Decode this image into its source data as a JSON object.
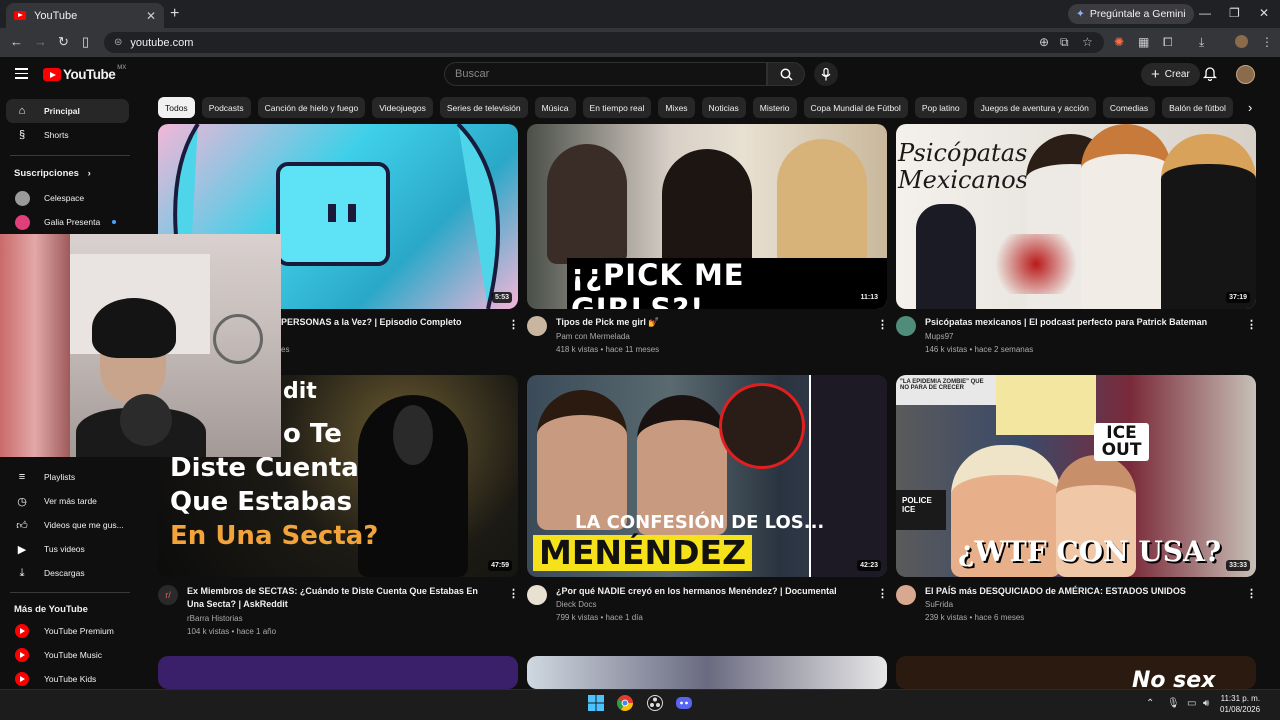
{
  "browser": {
    "tab_title": "YouTube",
    "new_tab": "+",
    "gemini_label": "Pregúntale a Gemini",
    "url": "youtube.com"
  },
  "yt": {
    "logo_text": "YouTube",
    "region": "MX",
    "search_placeholder": "Buscar",
    "create_label": "Crear"
  },
  "chips": [
    "Todos",
    "Podcasts",
    "Canción de hielo y fuego",
    "Videojuegos",
    "Series de televisión",
    "Música",
    "En tiempo real",
    "Mixes",
    "Noticias",
    "Misterio",
    "Copa Mundial de Fútbol",
    "Pop latino",
    "Juegos de aventura y acción",
    "Comedias",
    "Balón de fútbol"
  ],
  "sidebar": {
    "principal": "Principal",
    "shorts": "Shorts",
    "subs_header": "Suscripciones",
    "subs": [
      {
        "name": "Celespace",
        "color": "#b8b8b8"
      },
      {
        "name": "Galia Presenta",
        "color": "#e0407a"
      }
    ],
    "you_items": [
      "Playlists",
      "Ver más tarde",
      "Videos que me gus...",
      "Tus videos",
      "Descargas"
    ],
    "more_header": "Más de YouTube",
    "more_items": [
      "YouTube Premium",
      "YouTube Music",
      "YouTube Kids"
    ]
  },
  "videos": [
    {
      "title": "PERSONAS a la Vez? | Episodio Completo",
      "channel": "",
      "meta": "es",
      "duration": "5:53"
    },
    {
      "title": "Tipos de Pick me girl 💅",
      "channel": "Pam con Mermelada",
      "meta": "418 k vistas • hace 11 meses",
      "duration": "11:13",
      "overlay": "¡¿PICK ME GIRLS?!"
    },
    {
      "title": "Psicópatas mexicanos | El podcast perfecto para Patrick Bateman",
      "channel": "Mups97",
      "meta": "146 k vistas • hace 2 semanas",
      "duration": "37:19",
      "overlay": "Psicópatas Mexicanos"
    },
    {
      "title": "Ex Miembros de SECTAS: ¿Cuándo te Diste Cuenta Que Estabas En Una Secta? | AskReddit",
      "channel": "rBarra Historias",
      "meta": "104 k vistas • hace 1 año",
      "duration": "47:59",
      "overlay": [
        "dit",
        "o Te",
        "Diste Cuenta",
        "Que Estabas",
        "En Una Secta?"
      ]
    },
    {
      "title": "¿Por qué NADIE creyó en los hermanos Menéndez? | Documental",
      "channel": "Dieck Docs",
      "meta": "799 k vistas • hace 1 día",
      "duration": "42:23",
      "overlay": [
        "LA CONFESIÓN DE LOS...",
        "MENÉNDEZ"
      ]
    },
    {
      "title": "El PAÍS más DESQUICIADO de AMÉRICA: ESTADOS UNIDOS",
      "channel": "SuFrida",
      "meta": "239 k vistas • hace 6 meses",
      "duration": "33:33",
      "overlay": [
        "¿WTF CON USA?",
        "ICE OUT",
        "POLICE ICE",
        "\"LA EPIDEMIA ZOMBIE\" QUE NO PARA DE CRECER"
      ]
    }
  ],
  "bottom_row_overlay": "No sex",
  "taskbar": {
    "time": "11:31 p. m.",
    "date": "01/08/2026"
  }
}
